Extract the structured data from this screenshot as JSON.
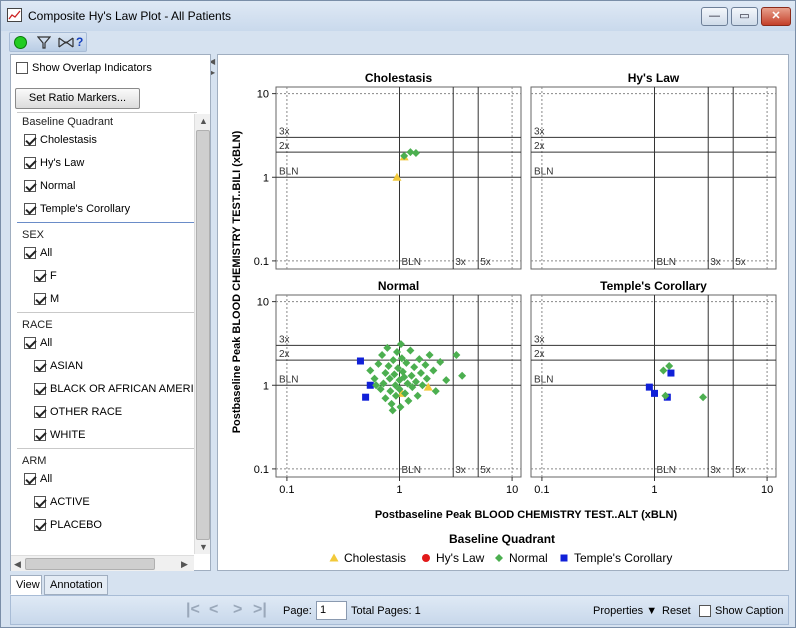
{
  "window": {
    "title": "Composite Hy's Law Plot - All Patients",
    "minimize": "—",
    "maximize": "▭",
    "close": "✕"
  },
  "toolbar": {
    "status_dot_color": "#22cc22",
    "help": "?"
  },
  "left_panel": {
    "overlap_label": "Show Overlap Indicators",
    "overlap_checked": false,
    "ratio_button": "Set Ratio Markers...",
    "groups": [
      {
        "header": "Baseline Quadrant",
        "items": [
          {
            "label": "Cholestasis",
            "checked": true,
            "indent": 0
          },
          {
            "label": "Hy's Law",
            "checked": true,
            "indent": 0
          },
          {
            "label": "Normal",
            "checked": true,
            "indent": 0
          },
          {
            "label": "Temple's Corollary",
            "checked": true,
            "indent": 0
          }
        ]
      },
      {
        "header": "SEX",
        "items": [
          {
            "label": "All",
            "checked": true,
            "indent": 0
          },
          {
            "label": "F",
            "checked": true,
            "indent": 1
          },
          {
            "label": "M",
            "checked": true,
            "indent": 1
          }
        ]
      },
      {
        "header": "RACE",
        "items": [
          {
            "label": "All",
            "checked": true,
            "indent": 0
          },
          {
            "label": "ASIAN",
            "checked": true,
            "indent": 1
          },
          {
            "label": "BLACK OR AFRICAN AMERICA",
            "checked": true,
            "indent": 1
          },
          {
            "label": "OTHER RACE",
            "checked": true,
            "indent": 1
          },
          {
            "label": "WHITE",
            "checked": true,
            "indent": 1
          }
        ]
      },
      {
        "header": "ARM",
        "items": [
          {
            "label": "All",
            "checked": true,
            "indent": 0
          },
          {
            "label": "ACTIVE",
            "checked": true,
            "indent": 1
          },
          {
            "label": "PLACEBO",
            "checked": true,
            "indent": 1
          }
        ]
      }
    ]
  },
  "tabs": [
    {
      "label": "View",
      "active": true
    },
    {
      "label": "Annotation",
      "active": false
    }
  ],
  "statusbar": {
    "page_label": "Page:",
    "page_value": "1",
    "total_pages": "Total Pages: 1",
    "properties": "Properties ▼",
    "reset": "Reset",
    "show_caption": "Show Caption",
    "show_caption_checked": false
  },
  "chart_data": {
    "type": "scatter",
    "scale": "log",
    "xlabel": "Postbaseline Peak BLOOD CHEMISTRY TEST..ALT (xBLN)",
    "ylabel": "Postbaseline Peak BLOOD CHEMISTRY TEST..BILI (xBLN)",
    "xlim": [
      0.08,
      12
    ],
    "ylim": [
      0.08,
      12
    ],
    "xticks": [
      "0.1",
      "1",
      "10"
    ],
    "yticks": [
      "10",
      "1",
      "0.1"
    ],
    "ref_lines_x": [
      {
        "value": 1,
        "label": "BLN"
      },
      {
        "value": 3,
        "label": "3x"
      },
      {
        "value": 5,
        "label": "5x"
      }
    ],
    "ref_lines_y": [
      {
        "value": 1,
        "label": "BLN"
      },
      {
        "value": 2,
        "label": "2x"
      },
      {
        "value": 3,
        "label": "3x"
      }
    ],
    "legend_title": "Baseline Quadrant",
    "legend_position": "bottom",
    "series": [
      {
        "name": "Cholestasis",
        "color": "#f2c93a",
        "marker": "triangle"
      },
      {
        "name": "Hy's Law",
        "color": "#e21a1a",
        "marker": "circle"
      },
      {
        "name": "Normal",
        "color": "#4caf50",
        "marker": "diamond"
      },
      {
        "name": "Temple's Corollary",
        "color": "#1020d8",
        "marker": "square"
      }
    ],
    "panels": [
      {
        "title": "Cholestasis",
        "points": [
          {
            "series": "Cholestasis",
            "x": 0.95,
            "y": 1.0
          },
          {
            "series": "Cholestasis",
            "x": 1.1,
            "y": 1.75
          },
          {
            "series": "Normal",
            "x": 1.1,
            "y": 1.8
          },
          {
            "series": "Normal",
            "x": 1.25,
            "y": 2.0
          },
          {
            "series": "Normal",
            "x": 1.4,
            "y": 1.95
          }
        ]
      },
      {
        "title": "Hy's Law",
        "points": []
      },
      {
        "title": "Normal",
        "points": [
          {
            "series": "Temple's Corollary",
            "x": 0.45,
            "y": 1.95
          },
          {
            "series": "Temple's Corollary",
            "x": 0.55,
            "y": 1.0
          },
          {
            "series": "Temple's Corollary",
            "x": 0.5,
            "y": 0.72
          },
          {
            "series": "Cholestasis",
            "x": 1.05,
            "y": 0.8
          },
          {
            "series": "Cholestasis",
            "x": 1.8,
            "y": 0.95
          },
          {
            "series": "Normal",
            "x": 0.55,
            "y": 1.5
          },
          {
            "series": "Normal",
            "x": 0.6,
            "y": 1.2
          },
          {
            "series": "Normal",
            "x": 0.65,
            "y": 1.8
          },
          {
            "series": "Normal",
            "x": 0.68,
            "y": 0.9
          },
          {
            "series": "Normal",
            "x": 0.7,
            "y": 2.3
          },
          {
            "series": "Normal",
            "x": 0.72,
            "y": 1.05
          },
          {
            "series": "Normal",
            "x": 0.75,
            "y": 1.4
          },
          {
            "series": "Normal",
            "x": 0.75,
            "y": 0.7
          },
          {
            "series": "Normal",
            "x": 0.78,
            "y": 2.8
          },
          {
            "series": "Normal",
            "x": 0.8,
            "y": 1.7
          },
          {
            "series": "Normal",
            "x": 0.82,
            "y": 1.2
          },
          {
            "series": "Normal",
            "x": 0.83,
            "y": 0.85
          },
          {
            "series": "Normal",
            "x": 0.85,
            "y": 0.6
          },
          {
            "series": "Normal",
            "x": 0.88,
            "y": 2.0
          },
          {
            "series": "Normal",
            "x": 0.9,
            "y": 1.35
          },
          {
            "series": "Normal",
            "x": 0.92,
            "y": 1.0
          },
          {
            "series": "Normal",
            "x": 0.93,
            "y": 0.75
          },
          {
            "series": "Normal",
            "x": 0.95,
            "y": 2.5
          },
          {
            "series": "Normal",
            "x": 0.97,
            "y": 1.6
          },
          {
            "series": "Normal",
            "x": 1.0,
            "y": 1.15
          },
          {
            "series": "Normal",
            "x": 1.0,
            "y": 0.9
          },
          {
            "series": "Normal",
            "x": 1.02,
            "y": 0.55
          },
          {
            "series": "Normal",
            "x": 1.05,
            "y": 2.1
          },
          {
            "series": "Normal",
            "x": 1.07,
            "y": 1.45
          },
          {
            "series": "Normal",
            "x": 1.1,
            "y": 1.25
          },
          {
            "series": "Normal",
            "x": 1.12,
            "y": 0.8
          },
          {
            "series": "Normal",
            "x": 1.15,
            "y": 1.85
          },
          {
            "series": "Normal",
            "x": 1.18,
            "y": 1.05
          },
          {
            "series": "Normal",
            "x": 1.2,
            "y": 0.65
          },
          {
            "series": "Normal",
            "x": 1.25,
            "y": 2.6
          },
          {
            "series": "Normal",
            "x": 1.28,
            "y": 1.3
          },
          {
            "series": "Normal",
            "x": 1.3,
            "y": 0.95
          },
          {
            "series": "Normal",
            "x": 1.35,
            "y": 1.65
          },
          {
            "series": "Normal",
            "x": 1.4,
            "y": 1.1
          },
          {
            "series": "Normal",
            "x": 1.45,
            "y": 0.75
          },
          {
            "series": "Normal",
            "x": 1.5,
            "y": 2.05
          },
          {
            "series": "Normal",
            "x": 1.55,
            "y": 1.4
          },
          {
            "series": "Normal",
            "x": 1.6,
            "y": 1.0
          },
          {
            "series": "Normal",
            "x": 1.7,
            "y": 1.75
          },
          {
            "series": "Normal",
            "x": 1.75,
            "y": 1.2
          },
          {
            "series": "Normal",
            "x": 1.85,
            "y": 2.3
          },
          {
            "series": "Normal",
            "x": 2.0,
            "y": 1.5
          },
          {
            "series": "Normal",
            "x": 2.1,
            "y": 0.85
          },
          {
            "series": "Normal",
            "x": 2.3,
            "y": 1.9
          },
          {
            "series": "Normal",
            "x": 2.6,
            "y": 1.15
          },
          {
            "series": "Normal",
            "x": 3.2,
            "y": 2.3
          },
          {
            "series": "Normal",
            "x": 3.6,
            "y": 1.3
          },
          {
            "series": "Normal",
            "x": 0.62,
            "y": 1.0
          },
          {
            "series": "Normal",
            "x": 1.03,
            "y": 3.1
          },
          {
            "series": "Normal",
            "x": 0.87,
            "y": 0.5
          }
        ]
      },
      {
        "title": "Temple's Corollary",
        "points": [
          {
            "series": "Temple's Corollary",
            "x": 0.9,
            "y": 0.95
          },
          {
            "series": "Temple's Corollary",
            "x": 1.0,
            "y": 0.8
          },
          {
            "series": "Temple's Corollary",
            "x": 1.4,
            "y": 1.4
          },
          {
            "series": "Temple's Corollary",
            "x": 1.3,
            "y": 0.72
          },
          {
            "series": "Normal",
            "x": 1.2,
            "y": 1.5
          },
          {
            "series": "Normal",
            "x": 1.35,
            "y": 1.7
          },
          {
            "series": "Normal",
            "x": 1.25,
            "y": 0.75
          },
          {
            "series": "Normal",
            "x": 2.7,
            "y": 0.72
          }
        ]
      }
    ]
  }
}
